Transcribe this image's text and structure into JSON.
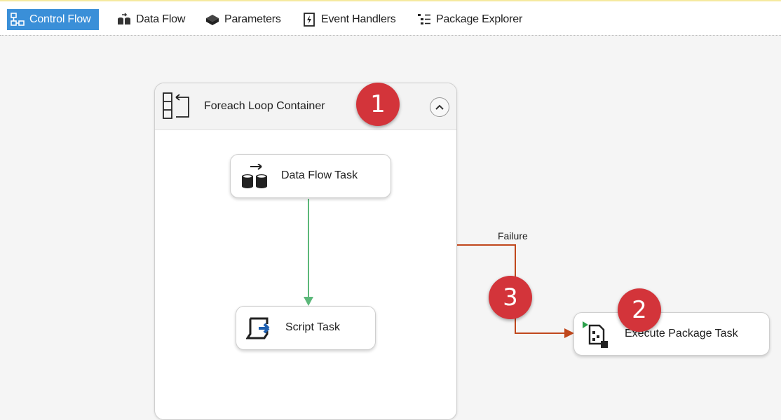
{
  "toolbar": {
    "tabs": [
      {
        "label": "Control Flow",
        "icon": "control-flow-icon",
        "active": true
      },
      {
        "label": "Data Flow",
        "icon": "data-flow-icon",
        "active": false
      },
      {
        "label": "Parameters",
        "icon": "parameters-icon",
        "active": false
      },
      {
        "label": "Event Handlers",
        "icon": "event-handlers-icon",
        "active": false
      },
      {
        "label": "Package Explorer",
        "icon": "package-explorer-icon",
        "active": false
      }
    ]
  },
  "container": {
    "title": "Foreach Loop Container",
    "icon": "foreach-loop-icon",
    "collapse_icon": "chevron-up-icon"
  },
  "tasks": {
    "data_flow": {
      "label": "Data Flow Task",
      "icon": "data-flow-task-icon"
    },
    "script": {
      "label": "Script Task",
      "icon": "script-task-icon"
    },
    "execute_package": {
      "label": "Execute Package Task",
      "icon": "execute-package-task-icon"
    }
  },
  "connectors": {
    "failure_label": "Failure",
    "success_color": "#5cb87a",
    "failure_color": "#c0471c"
  },
  "badges": {
    "one": "1",
    "two": "2",
    "three": "3",
    "color": "#d3343a"
  },
  "colors": {
    "active_tab": "#3a8fd8"
  }
}
